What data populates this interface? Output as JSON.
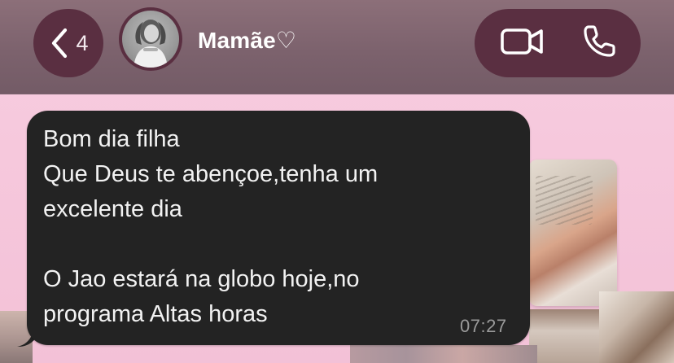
{
  "header": {
    "back_count": "4",
    "contact_name": "Mamãe♡"
  },
  "icons": {
    "back": "chevron-left-icon",
    "avatar": "contact-avatar",
    "video": "video-camera-icon",
    "call": "phone-icon"
  },
  "colors": {
    "header_bg": "#7c626d",
    "pill_bg": "#5a2f41",
    "wallpaper": "#f6c6dc",
    "bubble_bg": "#232323",
    "bubble_text": "#f2f2f2",
    "timestamp_text": "#9a9a9a"
  },
  "message": {
    "text": "Bom dia filha\nQue Deus te abençoe,tenha um\nexcelente dia\n\nO Jao estará na globo hoje,no\nprograma Altas horas",
    "time": "07:27"
  }
}
